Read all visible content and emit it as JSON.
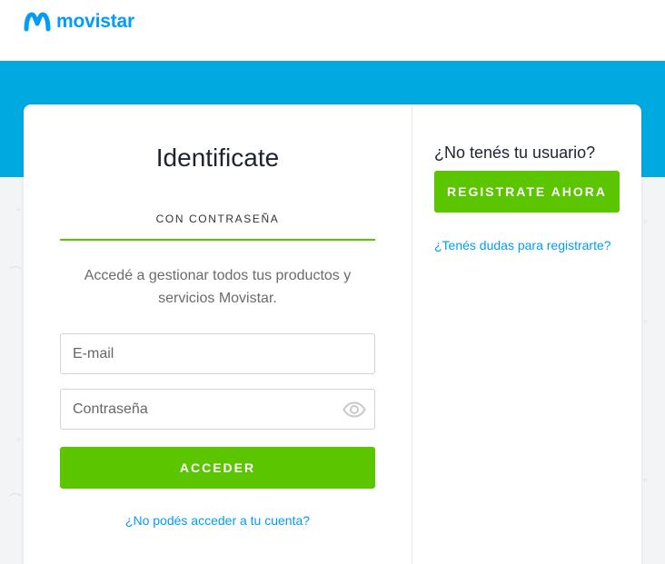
{
  "brand": {
    "name": "movistar",
    "color": "#019df4"
  },
  "colors": {
    "band": "#00a9e0",
    "accent_green": "#5bc500",
    "link": "#019df4"
  },
  "login": {
    "title": "Identificate",
    "tab_label": "CON CONTRASEÑA",
    "description": "Accedé a gestionar todos tus productos y servicios Movistar.",
    "email_placeholder": "E-mail",
    "password_placeholder": "Contraseña",
    "password_toggle_icon": "eye-icon",
    "submit_label": "ACCEDER",
    "forgot_link": "¿No podés acceder a tu cuenta?"
  },
  "register": {
    "title": "¿No tenés tu usuario?",
    "button_label": "REGISTRATE AHORA",
    "help_link": "¿Tenés dudas para registrarte?"
  }
}
